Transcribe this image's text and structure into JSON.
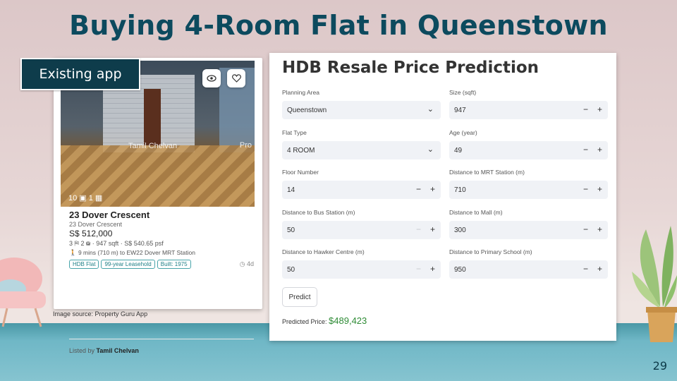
{
  "slide": {
    "title": "Buying 4-Room Flat in Queenstown",
    "page_number": "29"
  },
  "badge": {
    "label": "Existing app"
  },
  "image_source": "Image source: Property Guru App",
  "listing": {
    "watermark": "Tamil Chelvan",
    "watermark_brand": "Pro",
    "photo_counts": "10 ▣ 1 ▦",
    "title": "23 Dover Crescent",
    "subtitle": "23 Dover Crescent",
    "price": "S$ 512,000",
    "specs": "3 ⛿ 2 ⛁ · 947 sqft · S$ 540.65 psf",
    "mrt": "9 mins (710 m) to EW22 Dover MRT Station",
    "tags": [
      "HDB Flat",
      "99-year Leasehold",
      "Built: 1975"
    ],
    "age": "4d",
    "listed_by_prefix": "Listed by",
    "listed_by_name": "Tamil Chelvan"
  },
  "app": {
    "title": "HDB Resale Price Prediction",
    "fields": {
      "planning_area": {
        "label": "Planning Area",
        "value": "Queenstown"
      },
      "flat_type": {
        "label": "Flat Type",
        "value": "4 ROOM"
      },
      "floor_number": {
        "label": "Floor Number",
        "value": "14"
      },
      "bus_distance": {
        "label": "Distance to Bus Station (m)",
        "value": "50"
      },
      "hawker_distance": {
        "label": "Distance to Hawker Centre (m)",
        "value": "50"
      },
      "size": {
        "label": "Size (sqft)",
        "value": "947"
      },
      "age": {
        "label": "Age (year)",
        "value": "49"
      },
      "mrt_distance": {
        "label": "Distance to MRT Station (m)",
        "value": "710"
      },
      "mall_distance": {
        "label": "Distance to Mall (m)",
        "value": "300"
      },
      "school_distance": {
        "label": "Distance to Primary School (m)",
        "value": "950"
      }
    },
    "predict_label": "Predict",
    "predicted_label": "Predicted Price:",
    "predicted_value": "$489,423",
    "stepper_minus": "−",
    "stepper_plus": "+",
    "chevron": "⌄"
  },
  "colors": {
    "title": "#0c4a5e",
    "badge": "#0e3c4b",
    "tag": "#1e7f86",
    "price_green": "#2e8b35"
  }
}
